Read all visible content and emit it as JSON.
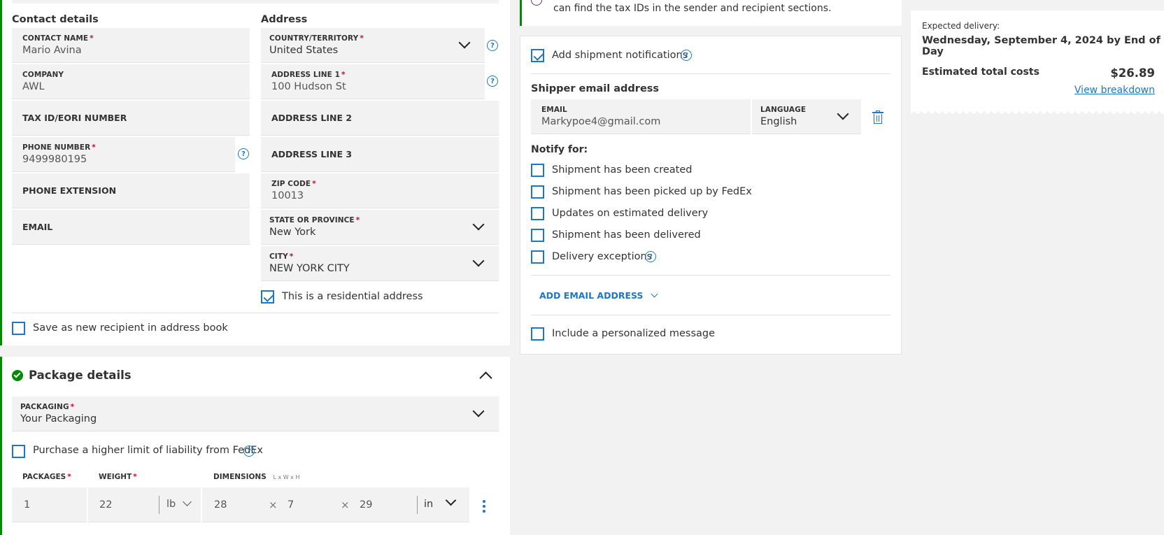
{
  "contact": {
    "heading": "Contact details",
    "contact_name_label": "CONTACT NAME",
    "contact_name": "Mario Avina",
    "company_label": "COMPANY",
    "company": "AWL",
    "tax_id_label": "TAX ID/EORI NUMBER",
    "phone_label": "PHONE NUMBER",
    "phone": "9499980195",
    "phone_ext_label": "PHONE EXTENSION",
    "email_label": "EMAIL"
  },
  "address": {
    "heading": "Address",
    "country_label": "COUNTRY/TERRITORY",
    "country": "United States",
    "line1_label": "ADDRESS LINE 1",
    "line1": "100 Hudson St",
    "line2_label": "ADDRESS LINE 2",
    "line3_label": "ADDRESS LINE 3",
    "zip_label": "ZIP CODE",
    "zip": "10013",
    "state_label": "STATE OR PROVINCE",
    "state": "New York",
    "city_label": "CITY",
    "city": "NEW YORK CITY",
    "residential_label": "This is a residential address",
    "residential_checked": true
  },
  "save_recipient_label": "Save as new recipient in address book",
  "package": {
    "heading": "Package details",
    "packaging_label": "PACKAGING",
    "packaging": "Your Packaging",
    "liability_label": "Purchase a higher limit of liability from FedEx",
    "packages_label": "PACKAGES",
    "packages": "1",
    "weight_label": "WEIGHT",
    "weight": "22",
    "weight_unit": "lb",
    "dimensions_label": "DIMENSIONS",
    "dimensions_hint": "L x W x H",
    "length": "28",
    "width": "7",
    "height": "29",
    "dim_unit": "in",
    "times": "×"
  },
  "tax_notice": {
    "text": "can find the tax IDs in the sender and recipient sections."
  },
  "notifications": {
    "add_label": "Add shipment notifications",
    "add_checked": true,
    "shipper_email_heading": "Shipper email address",
    "email_label": "EMAIL",
    "email": "Markypoe4@gmail.com",
    "language_label": "LANGUAGE",
    "language": "English",
    "notify_for": "Notify for:",
    "options": [
      "Shipment has been created",
      "Shipment has been picked up by FedEx",
      "Updates on estimated delivery",
      "Shipment has been delivered",
      "Delivery exceptions"
    ],
    "add_email_label": "ADD EMAIL ADDRESS",
    "personalized_label": "Include a personalized message"
  },
  "summary": {
    "expected_label": "Expected delivery:",
    "expected_value": "Wednesday, September 4, 2024 by End of Day",
    "total_label": "Estimated total costs",
    "total_value": "$26.89",
    "breakdown_link": "View breakdown"
  },
  "colors": {
    "accent": "#1d77c4",
    "green": "#008a00",
    "required": "#de002e"
  }
}
